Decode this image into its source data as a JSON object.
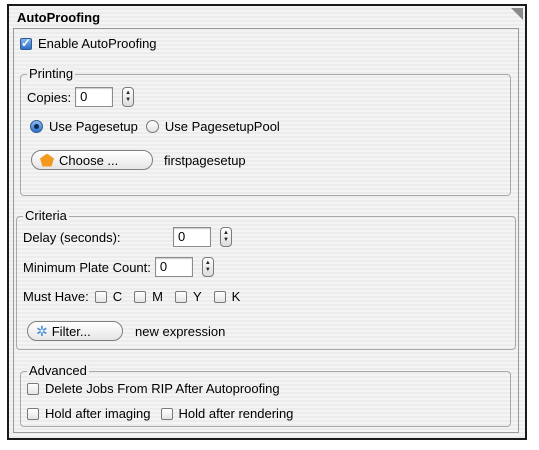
{
  "panel": {
    "title": "AutoProofing"
  },
  "enable": {
    "label": "Enable AutoProofing",
    "checked": true
  },
  "printing": {
    "legend": "Printing",
    "copies_label": "Copies:",
    "copies_value": "0",
    "radio_pagesetup": "Use Pagesetup",
    "radio_pagesetuppool": "Use PagesetupPool",
    "choose_button": "Choose ...",
    "choose_value": "firstpagesetup"
  },
  "criteria": {
    "legend": "Criteria",
    "delay_label": "Delay (seconds):",
    "delay_value": "0",
    "min_plate_label": "Minimum Plate Count:",
    "min_plate_value": "0",
    "must_have_label": "Must Have:",
    "colors": [
      "C",
      "M",
      "Y",
      "K"
    ],
    "filter_button": "Filter...",
    "filter_value": "new expression"
  },
  "advanced": {
    "legend": "Advanced",
    "delete_jobs": "Delete Jobs From RIP After Autoproofing",
    "hold_imaging": "Hold after imaging",
    "hold_rendering": "Hold after rendering"
  }
}
